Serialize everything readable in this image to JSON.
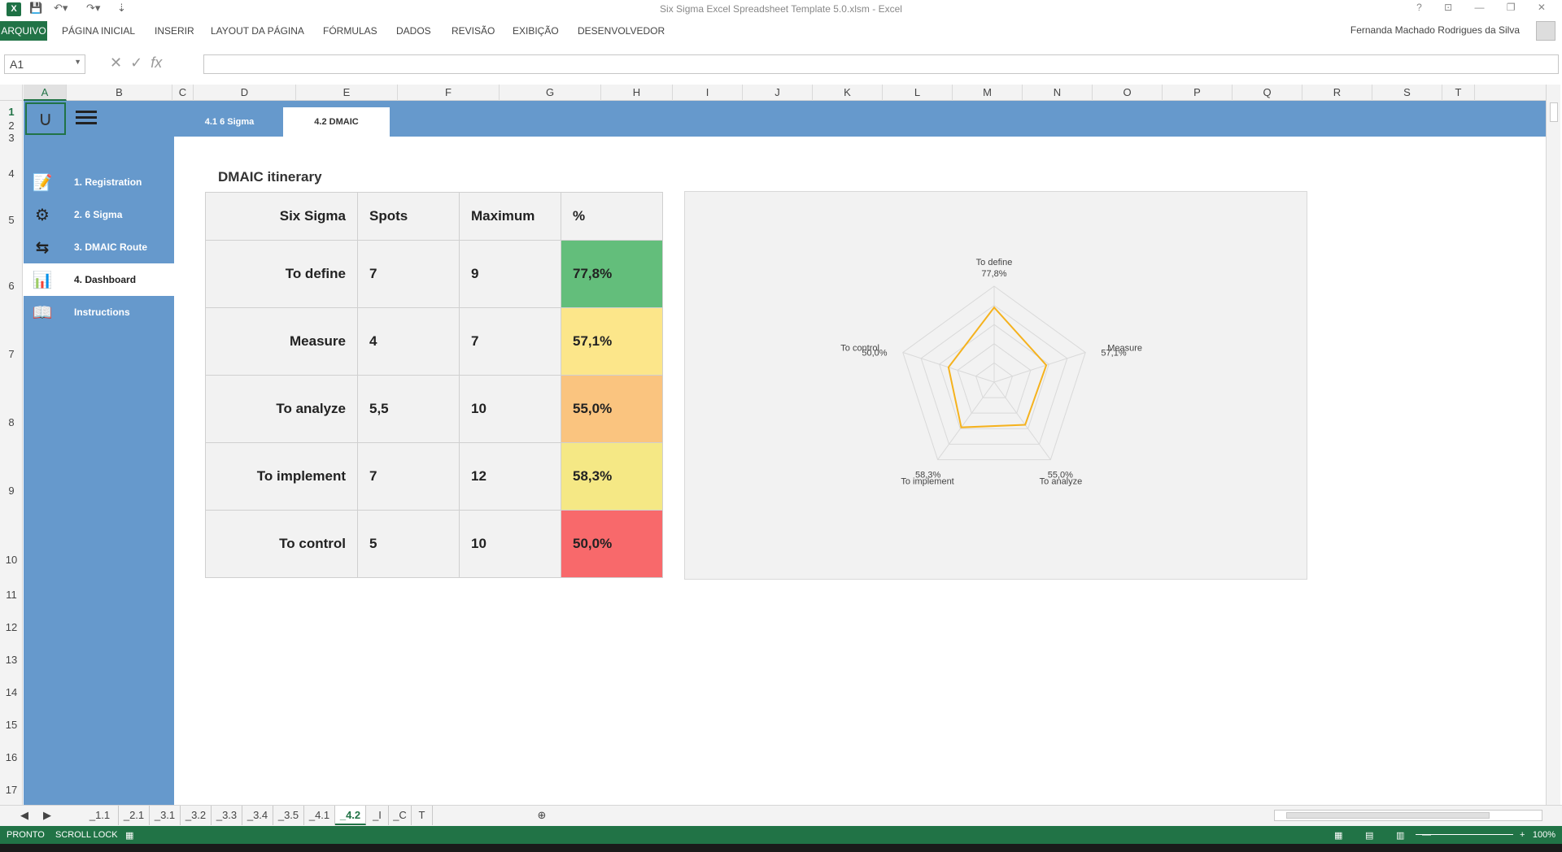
{
  "window": {
    "title": "Six Sigma Excel Spreadsheet Template 5.0.xlsm - Excel",
    "controls": "? ⊡ — ❐ ✕"
  },
  "ribbon": {
    "file_tab": "ARQUIVO",
    "tabs": [
      "PÁGINA INICIAL",
      "INSERIR",
      "LAYOUT DA PÁGINA",
      "FÓRMULAS",
      "DADOS",
      "REVISÃO",
      "EXIBIÇÃO",
      "DESENVOLVEDOR"
    ],
    "user": "Fernanda Machado Rodrigues da Silva"
  },
  "formula_bar": {
    "name_box": "A1",
    "fx": "fx",
    "formula": ""
  },
  "columns": [
    "A",
    "B",
    "C",
    "D",
    "E",
    "F",
    "G",
    "H",
    "I",
    "J",
    "K",
    "L",
    "M",
    "N",
    "O",
    "P",
    "Q",
    "R",
    "S",
    "T"
  ],
  "rows": [
    "1",
    "2",
    "3",
    "4",
    "5",
    "6",
    "7",
    "8",
    "9",
    "10",
    "11",
    "12",
    "13",
    "14",
    "15",
    "16",
    "17"
  ],
  "sidebar": {
    "items": [
      {
        "label": "1. Registration",
        "icon": "registration-icon",
        "glyph": "📝"
      },
      {
        "label": "2. 6 Sigma",
        "icon": "sigma-wheel-icon",
        "glyph": "⚙"
      },
      {
        "label": "3. DMAIC Route",
        "icon": "route-icon",
        "glyph": "⇆"
      },
      {
        "label": "4. Dashboard",
        "icon": "dashboard-icon",
        "glyph": "📊"
      },
      {
        "label": "Instructions",
        "icon": "instructions-icon",
        "glyph": "📖"
      }
    ]
  },
  "subtabs": [
    "4.1 6 Sigma",
    "4.2 DMAIC"
  ],
  "content": {
    "title": "DMAIC itinerary",
    "headers": [
      "Six Sigma",
      "Spots",
      "Maximum",
      "%"
    ],
    "rows": [
      {
        "stage": "To define",
        "spots": "7",
        "maximum": "9",
        "pct": "77,8%",
        "color": "#63be7b"
      },
      {
        "stage": "Measure",
        "spots": "4",
        "maximum": "7",
        "pct": "57,1%",
        "color": "#fce68a"
      },
      {
        "stage": "To analyze",
        "spots": "5,5",
        "maximum": "10",
        "pct": "55,0%",
        "color": "#fac47f"
      },
      {
        "stage": "To implement",
        "spots": "7",
        "maximum": "12",
        "pct": "58,3%",
        "color": "#f5e885"
      },
      {
        "stage": "To control",
        "spots": "5",
        "maximum": "10",
        "pct": "50,0%",
        "color": "#f8696b"
      }
    ]
  },
  "chart_data": {
    "type": "radar",
    "categories": [
      "To define",
      "Measure",
      "To analyze",
      "To implement",
      "To control"
    ],
    "values": [
      77.8,
      57.1,
      55.0,
      58.3,
      50.0
    ],
    "data_labels": [
      "77,8%",
      "57,1%",
      "55,0%",
      "58,3%",
      "50,0%"
    ],
    "range": [
      0,
      100
    ],
    "series_color": "#f5b21e",
    "grid": true
  },
  "sheet_tabs": [
    "_1.1",
    "_2.1",
    "_3.1",
    "_3.2",
    "_3.3",
    "_3.4",
    "_3.5",
    "_4.1",
    "_4.2",
    "_I",
    "_C",
    "T"
  ],
  "active_tab": "_4.2",
  "status": {
    "ready": "PRONTO",
    "scroll_lock": "SCROLL LOCK",
    "zoom": "100%"
  }
}
